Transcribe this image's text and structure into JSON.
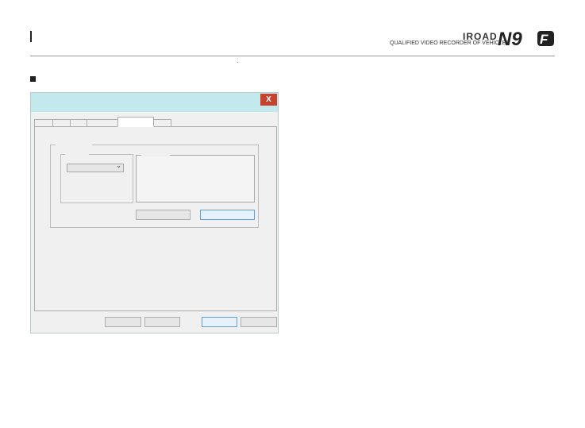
{
  "header": {
    "brand": "IROAD",
    "tagline": "QUALIFIED VIDEO RECORDER OF VEHICLES",
    "logo_text": "N9F"
  },
  "dialog": {
    "close_label": "X",
    "tabs": [
      "",
      "",
      "",
      "",
      "",
      ""
    ],
    "active_tab_index": 4
  },
  "colors": {
    "titlebar": "#c4e9ec",
    "close_button": "#c5432f",
    "default_button_border": "#5e9fd4"
  }
}
